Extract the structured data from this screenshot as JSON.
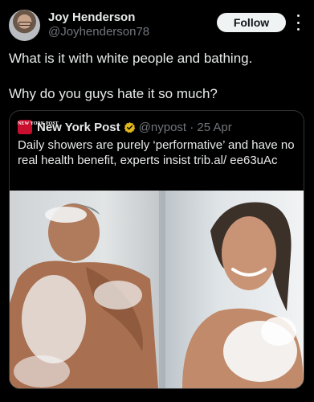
{
  "author": {
    "display_name": "Joy Henderson",
    "handle": "@Joyhenderson78",
    "follow_label": "Follow"
  },
  "tweet": {
    "line1": "What is it with white people and bathing.",
    "line2": "Why do you guys hate it so much?"
  },
  "quoted": {
    "logo_text": "NEW YORK POST",
    "name": "New York Post",
    "handle_date": "@nypost · 25 Apr",
    "text": "Daily showers are purely ‘performative’ and have no real health benefit, experts insist trib.al/ ee63uAc",
    "image_alt": "man-and-woman-showering-photo"
  },
  "colors": {
    "background": "#000000",
    "text": "#e7e9ea",
    "muted": "#71767b",
    "border": "#2f3336",
    "verified": "#e2b719",
    "nypost_red": "#c8102e"
  }
}
